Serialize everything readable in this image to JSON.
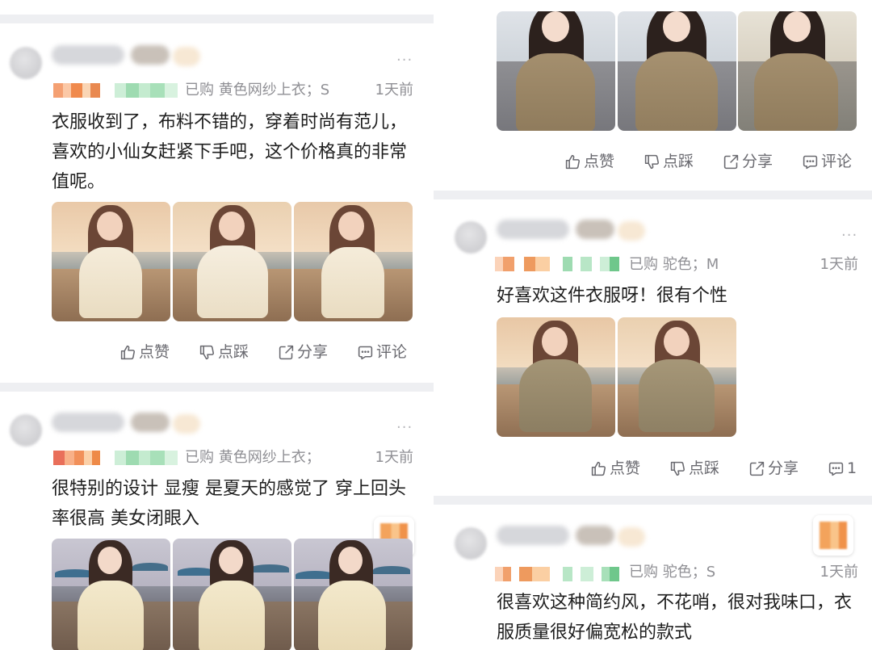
{
  "actions": {
    "like": "点赞",
    "dislike": "点踩",
    "share": "分享",
    "comment": "评论"
  },
  "icons": {
    "like": "thumbs-up-icon",
    "dislike": "thumbs-down-icon",
    "share": "share-icon",
    "comment": "comment-icon",
    "more": "more-dots-icon"
  },
  "colors": {
    "divider": "#eeeff2",
    "meta_text": "#8f8f94",
    "body_text": "#1e1e1e",
    "action_text": "#6a6a70"
  },
  "left_column": {
    "reviews": [
      {
        "purchase": "已购",
        "variant": "黄色网纱上衣；S",
        "time": "1天前",
        "text": "衣服收到了，布料不错的，穿着时尚有范儿，\n喜欢的小仙女赶紧下手吧，这个价格真的非常\n值呢。",
        "more": "···"
      },
      {
        "purchase": "已购",
        "variant": "黄色网纱上衣；",
        "time": "1天前",
        "text": "很特别的设计 显瘦 是夏天的感觉了 穿上回头\n率很高 美女闭眼入",
        "more": "···"
      }
    ]
  },
  "right_column": {
    "reviews": [
      {
        "purchase": "已购",
        "variant": "驼色；M",
        "time": "1天前",
        "text": "好喜欢这件衣服呀！很有个性",
        "comment_count": "1",
        "more": "···"
      },
      {
        "purchase": "已购",
        "variant": "驼色；S",
        "time": "1天前",
        "text": "很喜欢这种简约风，不花哨，很对我味口，衣\n服质量很好偏宽松的款式",
        "more": "···"
      }
    ]
  }
}
